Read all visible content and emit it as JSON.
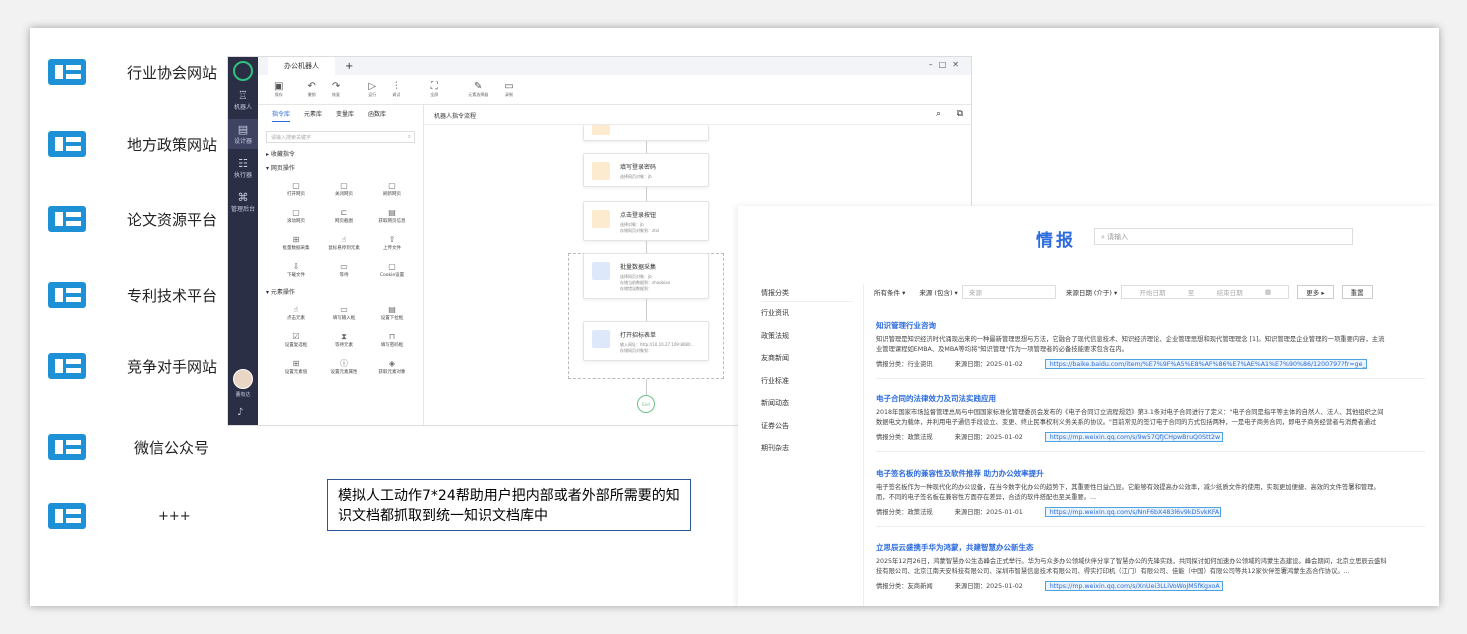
{
  "sources": [
    {
      "label": "行业协会网站",
      "icon": "website-icon"
    },
    {
      "label": "地方政策网站",
      "icon": "website-icon"
    },
    {
      "label": "论文资源平台",
      "icon": "website-icon"
    },
    {
      "label": "专利技术平台",
      "icon": "website-icon"
    },
    {
      "label": "竞争对手网站",
      "icon": "website-icon"
    },
    {
      "label": "微信公众号",
      "icon": "website-icon"
    },
    {
      "label": "+++",
      "icon": "website-icon"
    }
  ],
  "app": {
    "tab_title": "办公机器人",
    "side": [
      "机器人",
      "设计器",
      "执行器",
      "管理后台"
    ],
    "user_name": "董有达",
    "toolbar": [
      "保存",
      "撤销",
      "恢复",
      "运行",
      "调试",
      "全屏",
      "元素选择器",
      "录制"
    ],
    "lib_tabs": [
      "指令库",
      "元素库",
      "变量库",
      "函数库"
    ],
    "lib_search_placeholder": "请输入搜索关键字",
    "groups": {
      "fav": "收藏指令",
      "web": "网页操作",
      "elem": "元素操作"
    },
    "web_cmds": [
      "打开网页",
      "关闭网页",
      "刷新网页",
      "滚动网页",
      "网页截图",
      "获取网页信息",
      "批量数据采集",
      "鼠标悬停到元素",
      "上传文件",
      "下载文件",
      "等待",
      "Cookie设置"
    ],
    "elem_cmds": [
      "点击元素",
      "填写输入框",
      "设置下拉框",
      "设置复选框",
      "等待元素",
      "填写密码框",
      "设置元素值",
      "设置元素属性",
      "获取元素对象"
    ],
    "flow_title": "机器人指令流程",
    "flow": [
      {
        "title": "填写登录密码",
        "desc": "选择网页对象：jb"
      },
      {
        "title": "点击登录按钮",
        "desc": "选择对象：jb",
        "desc2": "存储网页对象到：ztxl"
      },
      {
        "title": "批量数据采集",
        "desc": "选择网页对象：jb",
        "desc2": "存储当前数据到：zhaobiao",
        "desc3": "存储错误数据到："
      },
      {
        "title": "打开招标表单",
        "desc": "输入网址：http://10.10.27.109:8080...",
        "desc2": "存储网页对象到："
      }
    ],
    "end_label": "End"
  },
  "callout": "模拟人工动作7*24帮助用户把内部或者外部所需要的知识文档都抓取到统一知识文档库中",
  "intel": {
    "title": "情报",
    "search_placeholder": "请输入",
    "category_head": "情报分类",
    "categories": [
      "行业资讯",
      "政策法规",
      "友商新闻",
      "行业标准",
      "新闻动态",
      "证券公告",
      "期刊杂志"
    ],
    "filters": {
      "all": "所有条件 ▾",
      "source_contains": "来源 (包含) ▾",
      "source_placeholder": "来源",
      "date_range": "来源日期 (介于) ▾",
      "start": "开始日期",
      "to": "至",
      "end": "结束日期",
      "more": "更多 ▸",
      "reset": "重置"
    },
    "results": [
      {
        "title": "知识管理行业咨询",
        "snippet": "知识管理是知识经济时代涌现出来的一种最新管理思想与方法，它融合了现代信息技术、知识经济理论、企业管理思想和现代管理理念 [1]。知识管理是企业管理的一项重要内容，主流",
        "snippet2": "业管理课程如EMBA、及MBA等均将\"知识管理\"作为一项管理者的必备技能要求包含在内。",
        "category": "情报分类：行业资讯",
        "date": "来源日期：2025-01-02",
        "link": "https://baike.baidu.com/item/%E7%9F%A5%E8%AF%86%E7%AE%A1%E7%90%86/1200797?fr=ge_ala"
      },
      {
        "title": "电子合同的法律效力及司法实践应用",
        "snippet": "2018年国家市场监督管理总局与中国国家标准化管理委员会发布的《电子合同订立流程规范》第3.1条对电子合同进行了定义：\"电子合同是指平等主体的自然人、法人、其他组织之间",
        "snippet2": "数据电文为载体，并利用电子通信手段设立、变更、终止民事权利义务关系的协议。\"目前常见的签订电子合同的方式包括两种，一是电子商务合同，即电子商务经营者与消费者通过",
        "category": "情报分类：政策法规",
        "date": "来源日期：2025-01-02",
        "link": "https://mp.weixin.qq.com/s/9w57QfJCHpwBruQ0Stt2w"
      },
      {
        "title": "电子签名板的兼容性及软件推荐 助力办公效率提升",
        "snippet": "电子签名板作为一种现代化的办公设备，在当今数字化办公的趋势下，其重要性日益凸显。它能够有效提高办公效率，减少纸质文件的使用，实现更加便捷、高效的文件签署和管理。",
        "snippet2": "而，不同的电子签名板在兼容性方面存在差异，合适的软件搭配也至关重要。...",
        "category": "情报分类：政策法规",
        "date": "来源日期：2025-01-01",
        "link": "https://mp.weixin.qq.com/s/NnF6bX483l6v9kD5vkKFA"
      },
      {
        "title": "立思辰云盛携手华为鸿蒙，共建智慧办公新生态",
        "snippet": "2025年12月26日，鸿蒙智慧办公生态峰会正式举行。华为与众多办公领域伙伴分享了智慧办公的先锋实践，共同探讨如何加速办公领域的鸿蒙生态建设。峰会期间，北京立思辰云盛科",
        "snippet2": "技有限公司、北京江南天安科技有限公司、深圳市智慧信息技术有限公司、得实打印机（江门）有限公司、佳能（中国）有限公司等共12家伙伴签署鸿蒙生态合作协议。...",
        "category": "情报分类：友商新闻",
        "date": "来源日期：2025-01-02",
        "link": "https://mp.weixin.qq.com/s/XnUei3LLiVoWoJM5fKgxoA"
      }
    ]
  },
  "colors": {
    "accent": "#1e90d6",
    "link": "#2d6cdf",
    "sidebar": "#2b2f45"
  }
}
